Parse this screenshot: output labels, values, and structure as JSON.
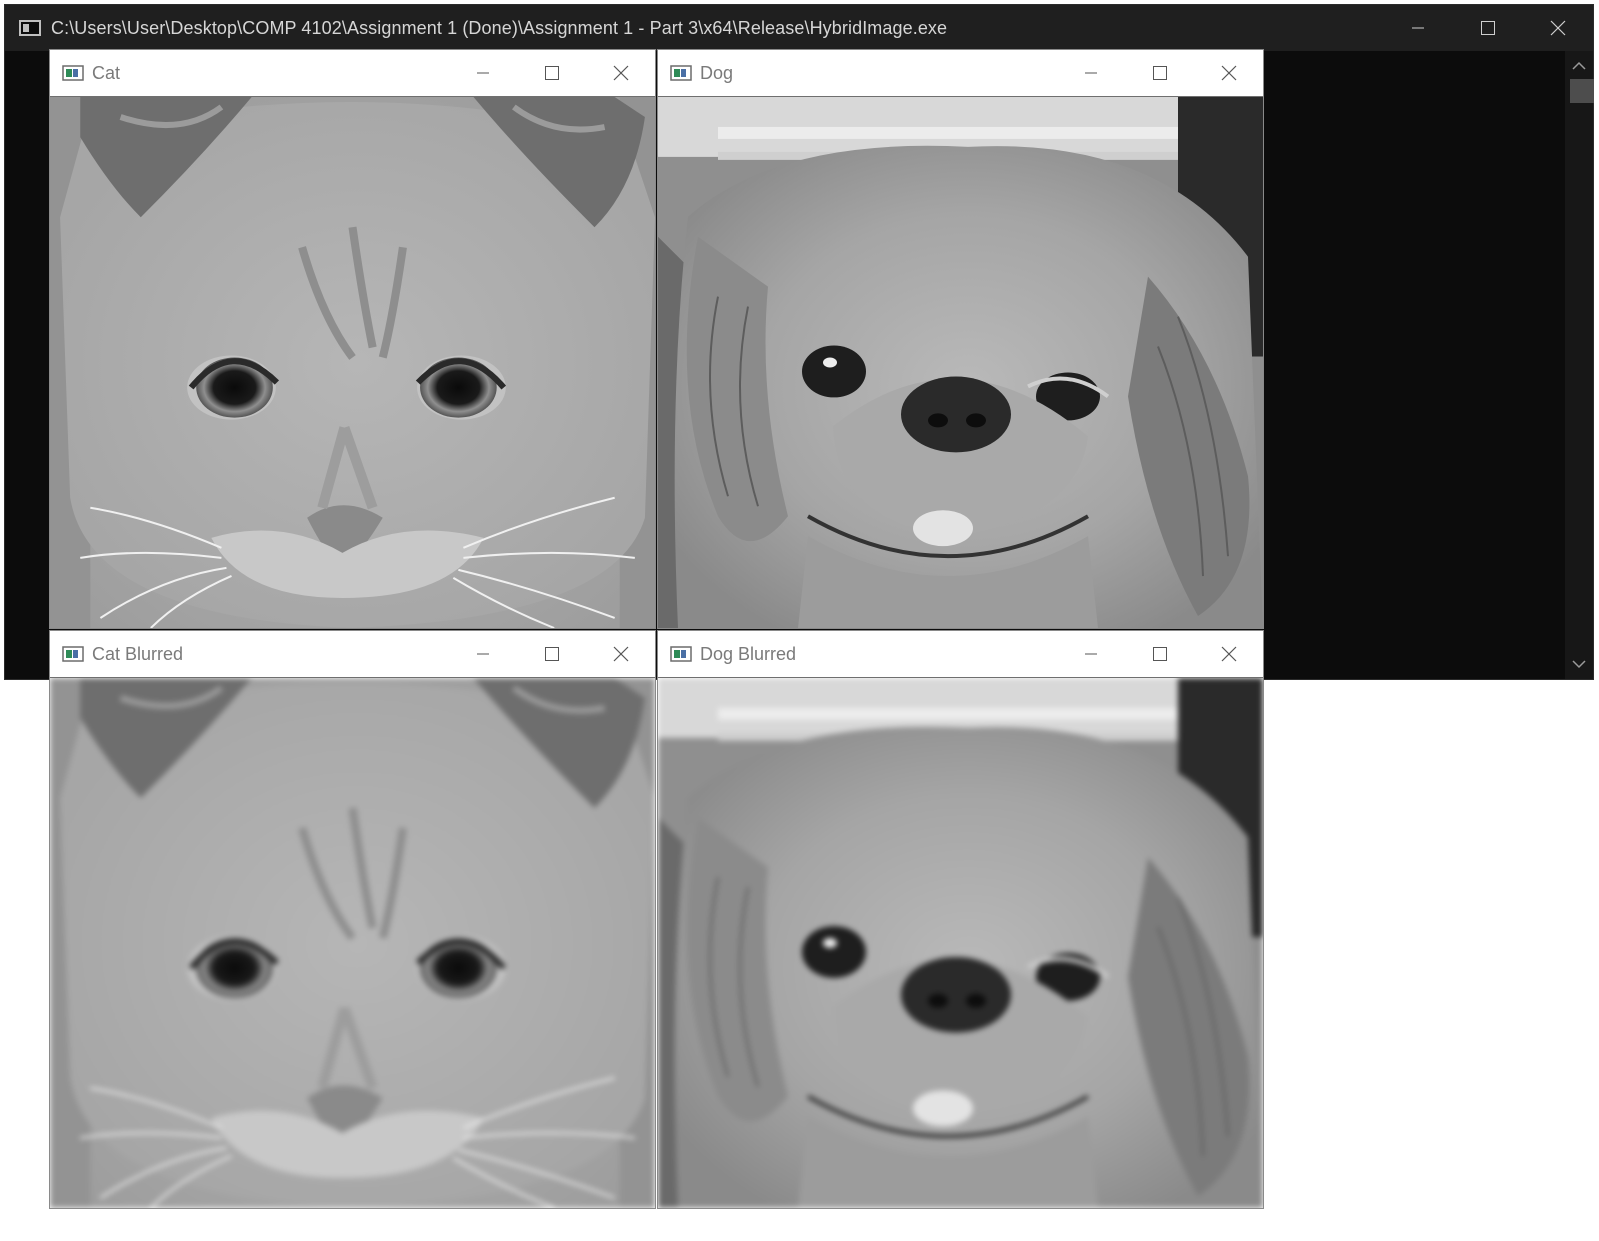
{
  "console": {
    "title": "C:\\Users\\User\\Desktop\\COMP 4102\\Assignment 1 (Done)\\Assignment 1 - Part 3\\x64\\Release\\HybridImage.exe",
    "icon": "console-app-icon"
  },
  "windows": {
    "cat": {
      "title": "Cat"
    },
    "dog": {
      "title": "Dog"
    },
    "cat_blurred": {
      "title": "Cat Blurred"
    },
    "dog_blurred": {
      "title": "Dog Blurred"
    }
  },
  "images": {
    "cat": "grayscale close-up photo of a kitten face",
    "dog": "grayscale close-up photo of a small long-haired dog face",
    "cat_blurred": "blurred grayscale kitten face",
    "dog_blurred": "blurred grayscale dog face"
  }
}
